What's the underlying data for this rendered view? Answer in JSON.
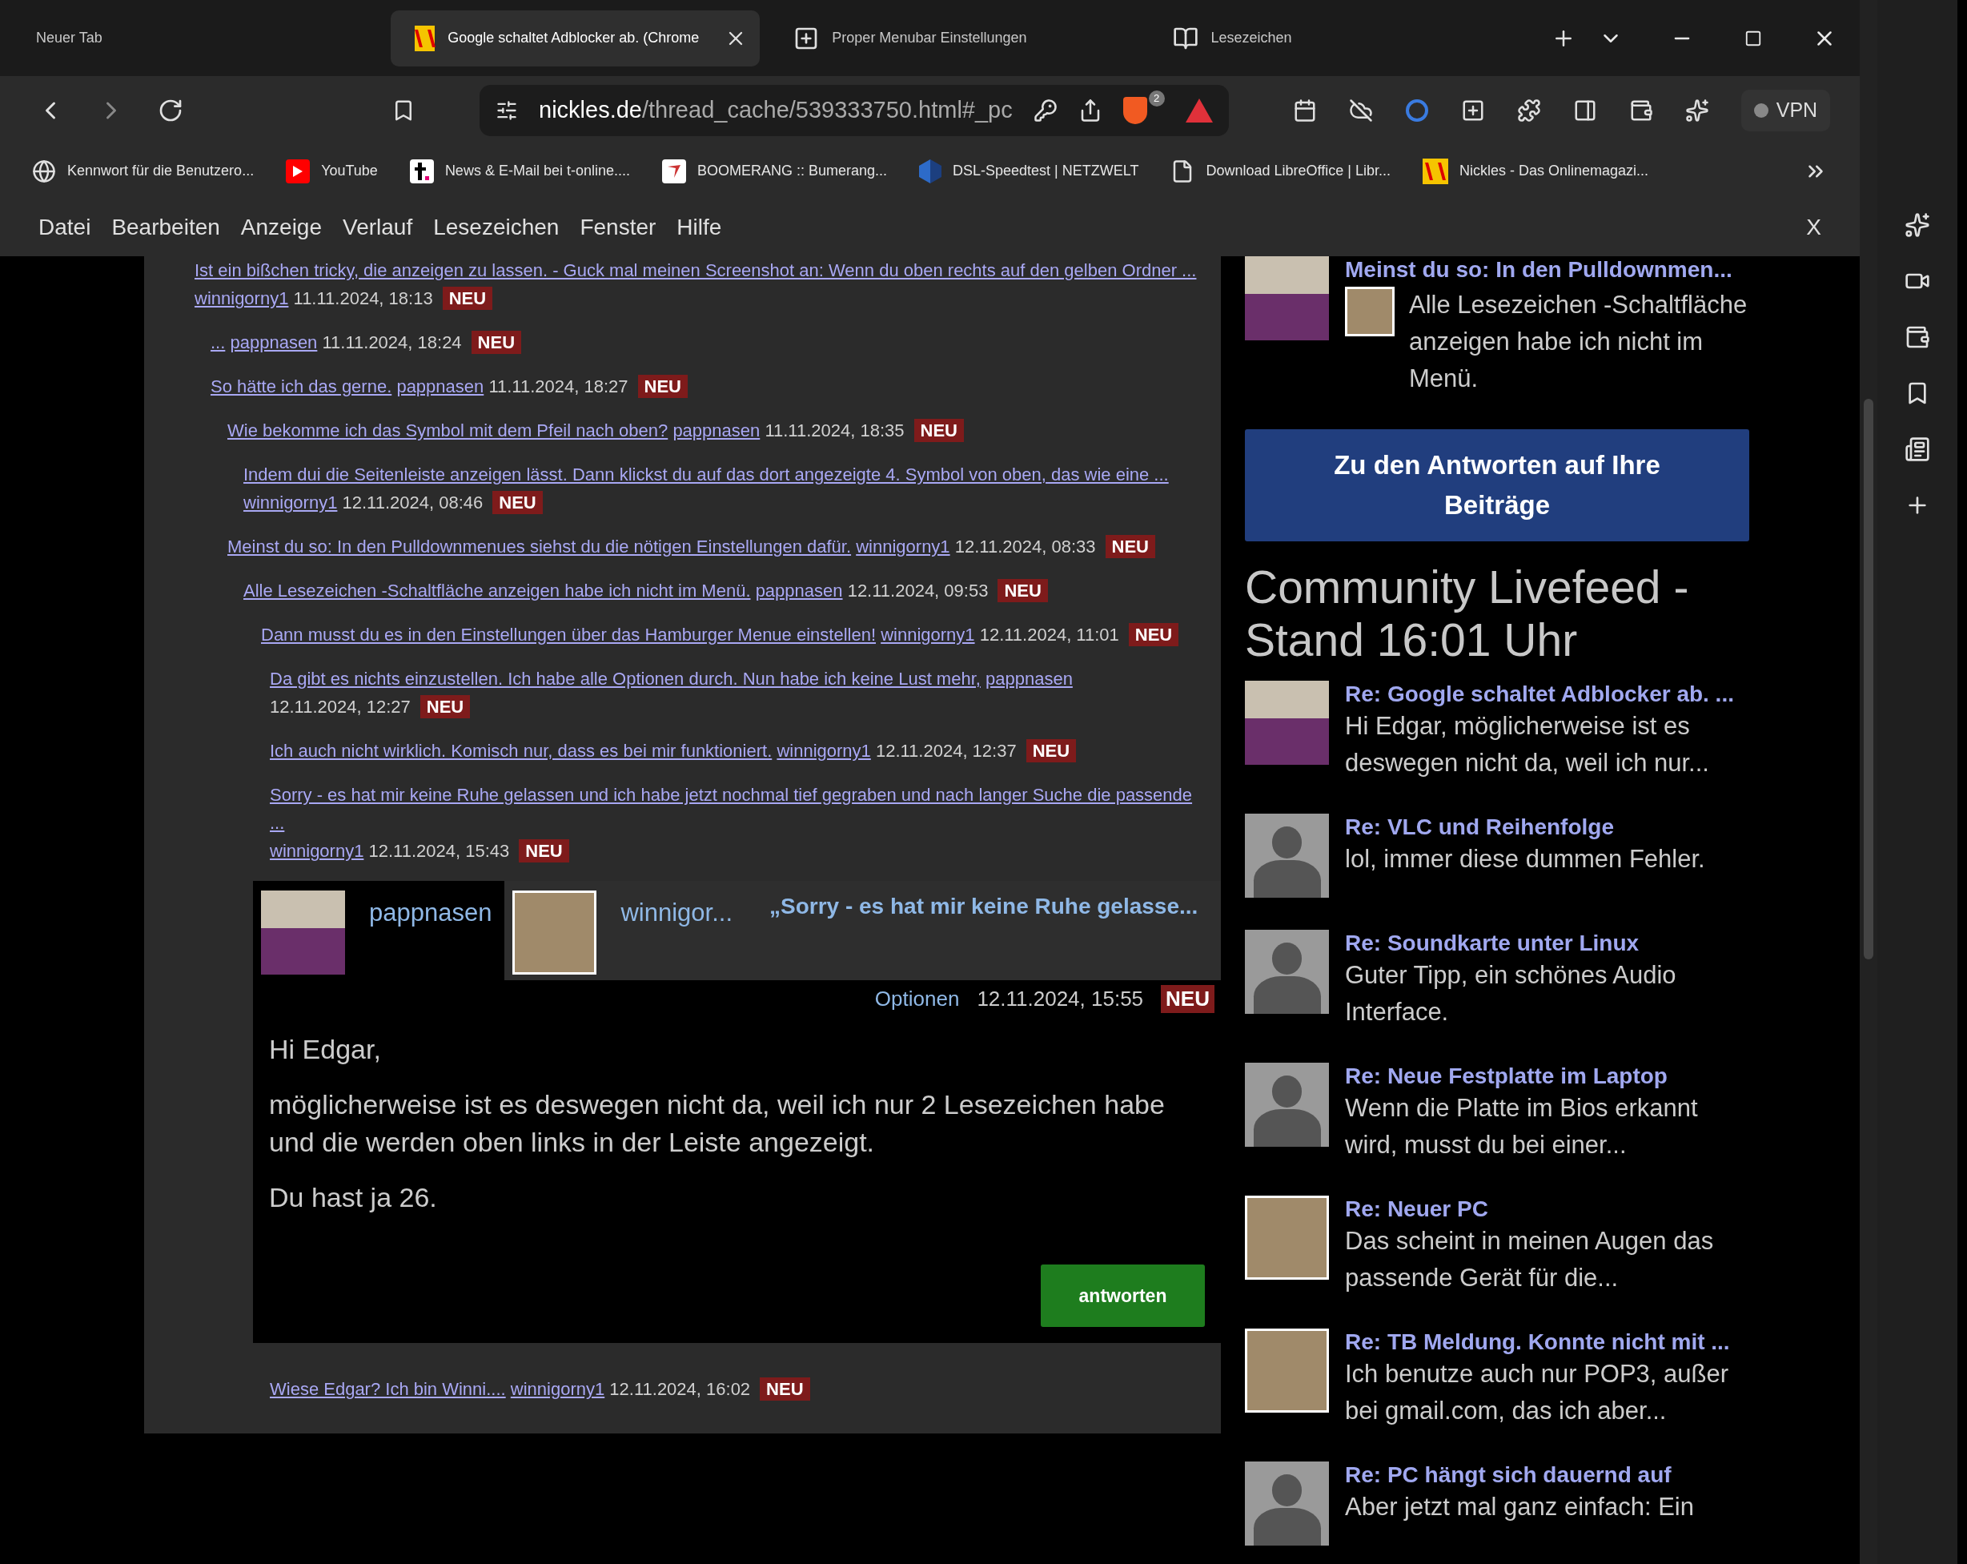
{
  "tabs": [
    {
      "label": "Neuer Tab",
      "selected": false
    },
    {
      "label": "Google schaltet Adblocker ab. (Chrome",
      "selected": true
    },
    {
      "label": "Proper Menubar Einstellungen",
      "selected": false
    },
    {
      "label": "Lesezeichen",
      "selected": false
    }
  ],
  "address": {
    "host": "nickles.de",
    "path": "/thread_cache/539333750.html#_pc"
  },
  "shield_badge": "2",
  "vpn_label": "VPN",
  "bookmarks": [
    "Kennwort für die Benutzero...",
    "YouTube",
    "News & E-Mail bei t-online....",
    "BOOMERANG :: Bumerang...",
    "DSL-Speedtest | NETZWELT",
    "Download LibreOffice | Libr...",
    "Nickles - Das Onlinemagazi..."
  ],
  "menubar": {
    "items": [
      "Datei",
      "Bearbeiten",
      "Anzeige",
      "Verlauf",
      "Lesezeichen",
      "Fenster",
      "Hilfe"
    ],
    "close": "X"
  },
  "thread": [
    {
      "kind": "reply",
      "title": "Ist ein bißchen tricky, die anzeigen zu lassen. - Guck mal meinen Screenshot an: Wenn du oben rechts auf den gelben Ordner ...",
      "author": "winnigorny1",
      "date": "11.11.2024, 18:13",
      "badge": "NEU",
      "children": [
        {
          "kind": "reply",
          "title": "...",
          "author": "pappnasen",
          "date": "11.11.2024, 18:24",
          "badge": "NEU"
        },
        {
          "kind": "reply",
          "title": "So hätte ich das gerne.",
          "author": "pappnasen",
          "date": "11.11.2024, 18:27",
          "badge": "NEU",
          "children": [
            {
              "kind": "reply",
              "title": "Wie bekomme ich das Symbol mit dem Pfeil nach oben?",
              "author": "pappnasen",
              "date": "11.11.2024, 18:35",
              "badge": "NEU",
              "children": [
                {
                  "kind": "reply",
                  "title": "Indem dui die Seitenleiste anzeigen lässt. Dann klickst du auf das dort angezeigte 4. Symbol von oben, das wie eine ...",
                  "author": "winnigorny1",
                  "date": "12.11.2024, 08:46",
                  "badge": "NEU"
                }
              ]
            },
            {
              "kind": "reply",
              "title": "Meinst du so: In den Pulldownmenues siehst du die nötigen Einstellungen dafür.",
              "author": "winnigorny1",
              "date": "12.11.2024, 08:33",
              "badge": "NEU",
              "children": [
                {
                  "kind": "reply",
                  "title": "Alle Lesezeichen -Schaltfläche anzeigen habe ich nicht im Menü.",
                  "author": "pappnasen",
                  "date": "12.11.2024, 09:53",
                  "badge": "NEU",
                  "children": [
                    {
                      "kind": "reply",
                      "title": "Dann musst du es in den Einstellungen über das Hamburger Menue einstellen!",
                      "author": "winnigorny1",
                      "date": "12.11.2024, 11:01",
                      "badge": "NEU",
                      "children": [
                        {
                          "kind": "reply",
                          "title": "Da gibt es nichts einzustellen. Ich habe alle Optionen durch. Nun habe ich keine Lust mehr,",
                          "author": "pappnasen",
                          "date": "12.11.2024, 12:27",
                          "badge": "NEU",
                          "children": [
                            {
                              "kind": "reply",
                              "title": "Ich auch nicht wirklich. Komisch nur, dass es bei mir funktioniert.",
                              "author": "winnigorny1",
                              "date": "12.11.2024, 12:37",
                              "badge": "NEU",
                              "children": [
                                {
                                  "kind": "reply",
                                  "title": "Sorry - es hat mir keine Ruhe gelassen und ich habe jetzt nochmal tief gegraben und nach langer Suche die passende ...",
                                  "author": "winnigorny1",
                                  "date": "12.11.2024, 15:43",
                                  "badge": "NEU",
                                  "children": [
                                    {
                                      "kind": "post",
                                      "authors": [
                                        {
                                          "name": "pappnasen",
                                          "selected": true
                                        },
                                        {
                                          "name": "winnigor...",
                                          "selected": false
                                        }
                                      ],
                                      "title": "„Sorry - es hat mir keine Ruhe gelasse...",
                                      "options": "Optionen",
                                      "date": "12.11.2024, 15:55",
                                      "badge": "NEU",
                                      "paragraphs": [
                                        "Hi Edgar,",
                                        "möglicherweise ist es deswegen nicht da, weil ich nur 2 Lesezeichen habe und die werden oben links in der Leiste angezeigt.",
                                        "Du hast ja 26."
                                      ],
                                      "reply_button": "antworten"
                                    },
                                    {
                                      "kind": "reply",
                                      "title": "Wiese Edgar? Ich bin Winni....",
                                      "author": "winnigorny1",
                                      "date": "12.11.2024, 16:02",
                                      "badge": "NEU"
                                    }
                                  ]
                                }
                              ]
                            }
                          ]
                        }
                      ]
                    }
                  ]
                }
              ]
            }
          ]
        }
      ]
    }
  ],
  "sidebar_top": {
    "title": "Meinst du so: In den Pulldownmen...",
    "text": "Alle Lesezeichen -Schaltfläche anzeigen habe ich nicht im Menü."
  },
  "answers_button": "Zu den Antworten auf Ihre Beiträge",
  "livefeed": {
    "heading": "Community Livefeed - Stand 16:01 Uhr",
    "items": [
      {
        "title": "Re: Google schaltet Adblocker ab. ...",
        "text": "Hi Edgar, möglicherweise ist es deswegen nicht da, weil ich nur..."
      },
      {
        "title": "Re: VLC und Reihenfolge",
        "text": "lol, immer diese dummen Fehler."
      },
      {
        "title": "Re: Soundkarte unter Linux",
        "text": "Guter Tipp, ein schönes Audio Interface."
      },
      {
        "title": "Re: Neue Festplatte im Laptop",
        "text": "Wenn die Platte im Bios erkannt wird, musst du bei einer..."
      },
      {
        "title": "Re: Neuer PC",
        "text": "Das scheint in meinen Augen das passende Gerät für die..."
      },
      {
        "title": "Re: TB Meldung. Konnte nicht mit ...",
        "text": "Ich benutze auch nur POP3, außer bei gmail.com, das ich aber..."
      },
      {
        "title": "Re: PC hängt sich dauernd auf",
        "text": "Aber jetzt mal ganz einfach: Ein"
      }
    ]
  }
}
